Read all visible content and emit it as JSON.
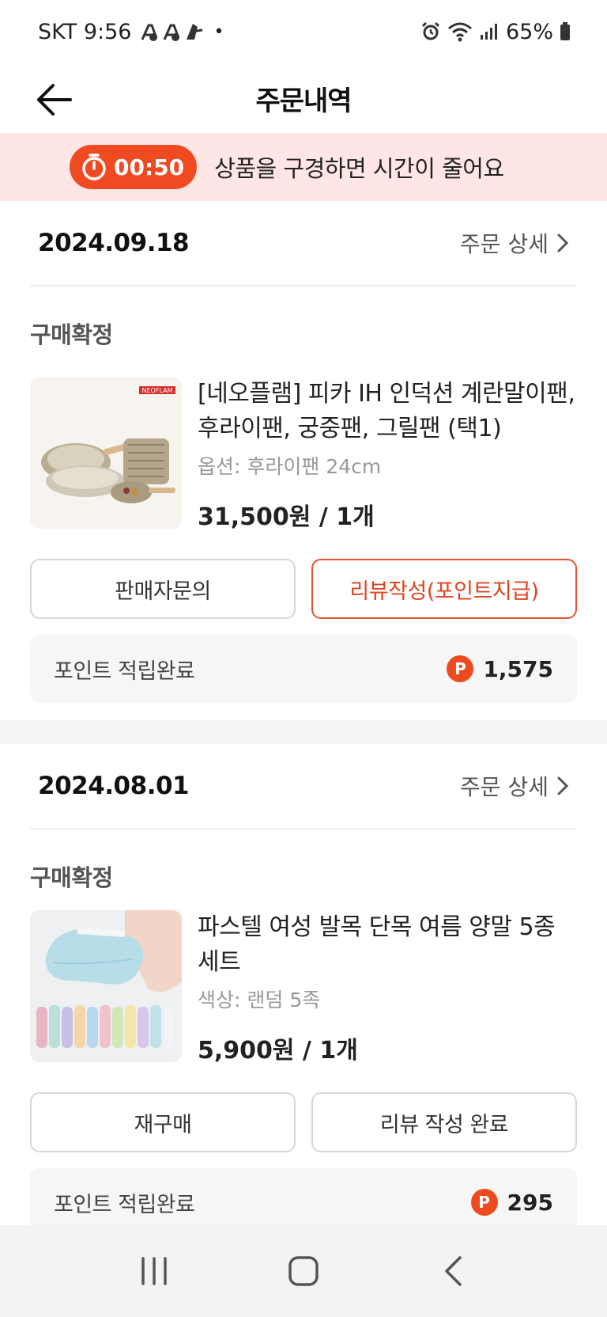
{
  "status_bar": {
    "carrier_time": "SKT 9:56",
    "dot": "•",
    "battery": "65%"
  },
  "header": {
    "title": "주문내역"
  },
  "banner": {
    "timer": "00:50",
    "message": "상품을 구경하면 시간이 줄어요"
  },
  "colors": {
    "accent": "#f04a23",
    "banner_bg": "#fde6e3"
  },
  "orders": [
    {
      "date": "2024.09.18",
      "detail_link": "주문 상세",
      "status": "구매확정",
      "product_name": "[네오플램] 피카 IH 인덕션 계란말이팬, 후라이팬, 궁중팬, 그릴팬 (택1)",
      "option": "옵션: 후라이팬 24cm",
      "price": "31,500원 / 1개",
      "thumb_brand": "NEOFLAM",
      "button_left": "판매자문의",
      "button_right": "리뷰작성(포인트지급)",
      "points_label": "포인트 적립완료",
      "points_icon": "P",
      "points_value": "1,575"
    },
    {
      "date": "2024.08.01",
      "detail_link": "주문 상세",
      "status": "구매확정",
      "product_name": "파스텔 여성 발목 단목 여름 양말 5종 세트",
      "option": "색상: 랜덤 5족",
      "price": "5,900원 / 1개",
      "button_left": "재구매",
      "button_right": "리뷰 작성 완료",
      "points_label": "포인트 적립완료",
      "points_icon": "P",
      "points_value": "295"
    }
  ]
}
